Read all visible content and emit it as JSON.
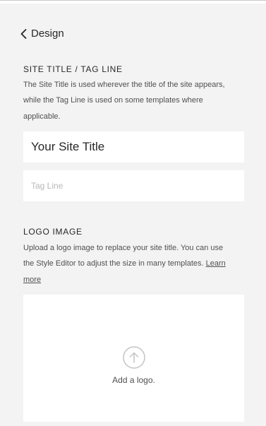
{
  "nav": {
    "back_label": "Design"
  },
  "site_title_section": {
    "heading": "SITE TITLE / TAG LINE",
    "description_lines": [
      "The Site Title is used wherever the title of the site appears,",
      "while the Tag Line is used on some templates where",
      "applicable."
    ],
    "site_title_value": "Your Site Title",
    "tag_line_value": "",
    "tag_line_placeholder": "Tag Line"
  },
  "logo_section": {
    "heading": "LOGO IMAGE",
    "description_lines": [
      "Upload a logo image to replace your site title. You can use",
      "the Style Editor to adjust the size in many templates."
    ],
    "learn_more_part1": "Learn",
    "learn_more_part2": "more",
    "add_logo_label": "Add a logo."
  },
  "icons": {
    "back": "chevron-left-icon",
    "upload": "upload-arrow-icon"
  },
  "colors": {
    "panel_background": "#f3f3f3",
    "field_background": "#ffffff",
    "text_primary": "#272727",
    "text_secondary": "#505050",
    "placeholder": "#b8b8b8",
    "icon_light": "#c4c4c4"
  }
}
